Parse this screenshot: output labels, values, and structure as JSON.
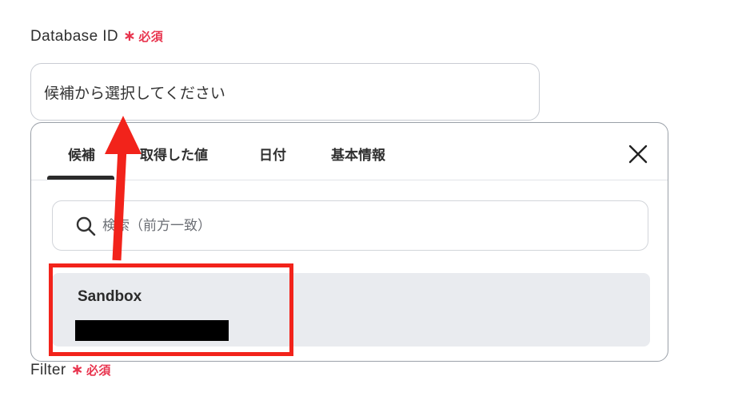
{
  "database_id": {
    "label": "Database ID",
    "required_star": "∗",
    "required_text": "必須",
    "placeholder": "候補から選択してください"
  },
  "dropdown": {
    "tabs": [
      {
        "label": "候補",
        "active": true
      },
      {
        "label": "取得した値",
        "active": false
      },
      {
        "label": "日付",
        "active": false
      },
      {
        "label": "基本情報",
        "active": false
      }
    ],
    "search_placeholder": "検索（前方一致）",
    "options": [
      {
        "title": "Sandbox",
        "subtitle_redacted": true
      }
    ]
  },
  "filter": {
    "label": "Filter",
    "required_star": "∗",
    "required_text": "必須"
  },
  "annotation": {
    "color": "#f2231b"
  }
}
